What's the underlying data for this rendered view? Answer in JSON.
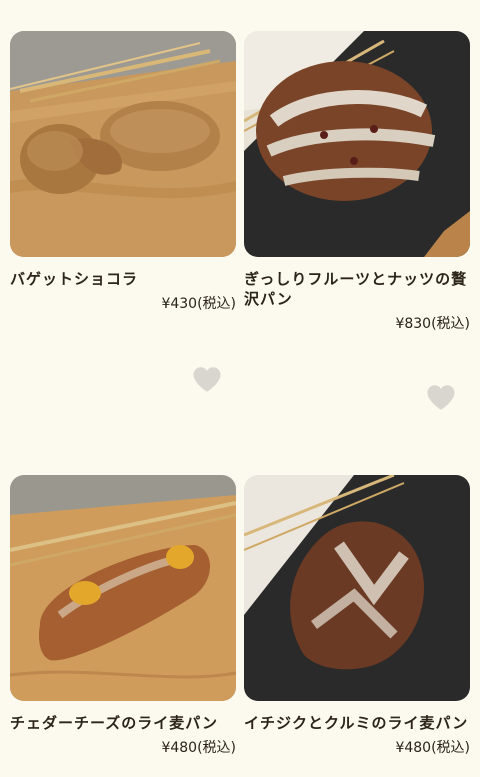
{
  "products": [
    {
      "name": "バゲットショコラ",
      "price": "¥430(税込)",
      "image_icon": "baguette-chocolat-photo"
    },
    {
      "name": "ぎっしりフルーツとナッツの贅沢パン",
      "price": "¥830(税込)",
      "image_icon": "fruit-nut-bread-photo"
    },
    {
      "name": "チェダーチーズのライ麦パン",
      "price": "¥480(税込)",
      "image_icon": "cheddar-rye-bread-photo"
    },
    {
      "name": "イチジクとクルミのライ麦パン",
      "price": "¥480(税込)",
      "image_icon": "fig-walnut-rye-bread-photo"
    }
  ],
  "favorite_icon": "heart-icon",
  "colors": {
    "background": "#fcf9ef",
    "text": "#2b2418",
    "heart": "#d9d6cf"
  }
}
